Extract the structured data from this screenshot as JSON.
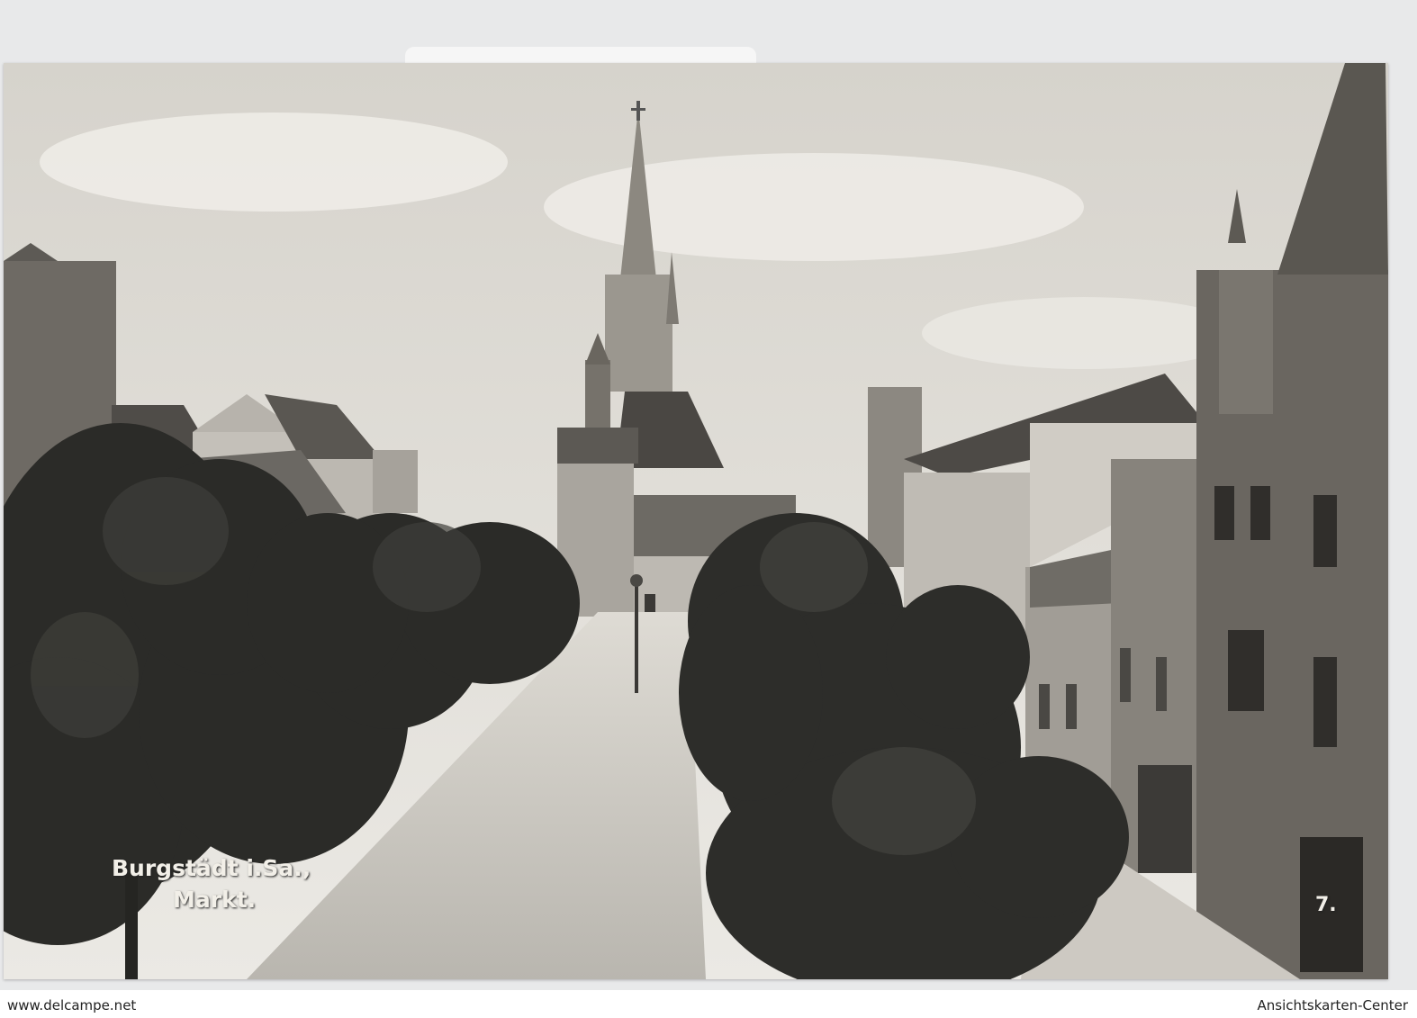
{
  "postcard": {
    "caption_line1": "Burgstädt i.Sa.,",
    "caption_line2": "Markt.",
    "card_number": "7."
  },
  "footer": {
    "left_text": "www.delcampe.net",
    "right_text": "Ansichtskarten-Center"
  },
  "colors": {
    "sky": "#e3e1dc",
    "tree": "#2a2a27",
    "road": "#c9c6bf",
    "building": "#8f8b84"
  }
}
